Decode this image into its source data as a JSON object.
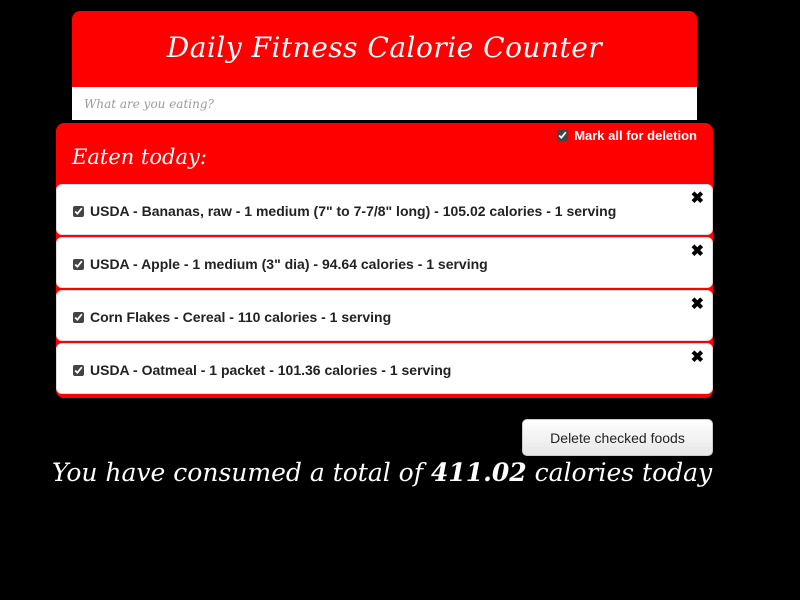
{
  "header": {
    "title": "Daily Fitness Calorie Counter"
  },
  "search": {
    "placeholder": "What are you eating?"
  },
  "eaten_panel": {
    "mark_all_label": "Mark all for deletion",
    "mark_all_checked": true,
    "title": "Eaten today:",
    "remove_icon": "close-icon",
    "items": [
      {
        "checked": true,
        "text": "USDA - Bananas, raw - 1 medium (7\" to 7-7/8\" long) - 105.02 calories - 1 serving"
      },
      {
        "checked": true,
        "text": "USDA - Apple - 1 medium (3\" dia) - 94.64 calories - 1 serving"
      },
      {
        "checked": true,
        "text": "Corn Flakes - Cereal - 110 calories - 1 serving"
      },
      {
        "checked": true,
        "text": "USDA - Oatmeal - 1 packet - 101.36 calories - 1 serving"
      }
    ]
  },
  "actions": {
    "delete_label": "Delete checked foods"
  },
  "summary": {
    "prefix": "You have consumed a total of",
    "total": "411.02",
    "suffix": "calories today"
  },
  "colors": {
    "accent": "#ff0000",
    "background": "#000000"
  }
}
